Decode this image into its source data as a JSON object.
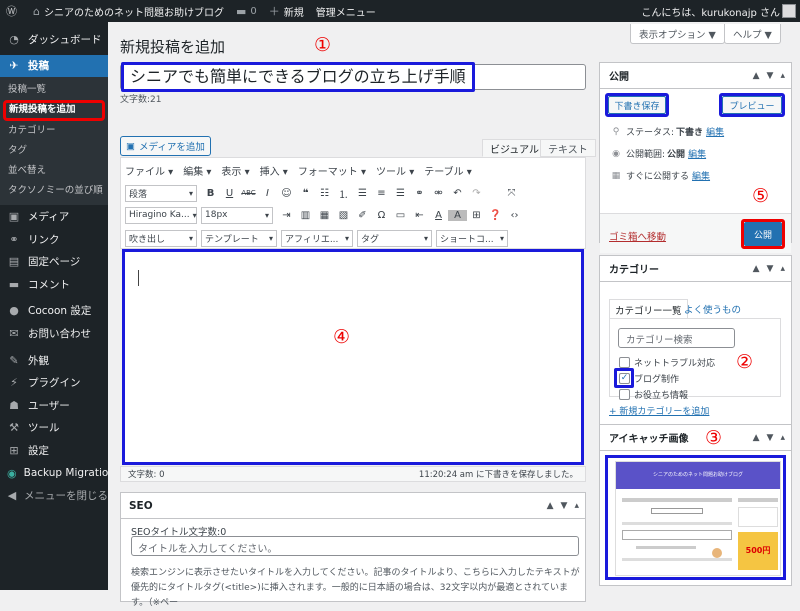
{
  "adminbar": {
    "site_name": "シニアのためのネット問題お助けブログ",
    "comments_count": "0",
    "new_label": "新規",
    "admin_menu_label": "管理メニュー",
    "greeting": "こんにちは、kurukonajp さん"
  },
  "sidebar": {
    "items": [
      {
        "label": "ダッシュボード",
        "icon": "dashboard-icon"
      },
      {
        "label": "投稿",
        "icon": "pin-icon"
      },
      {
        "label": "メディア",
        "icon": "media-icon"
      },
      {
        "label": "リンク",
        "icon": "link-icon"
      },
      {
        "label": "固定ページ",
        "icon": "page-icon"
      },
      {
        "label": "コメント",
        "icon": "comment-icon"
      },
      {
        "label": "Cocoon 設定",
        "icon": "cocoon-icon"
      },
      {
        "label": "お問い合わせ",
        "icon": "mail-icon"
      },
      {
        "label": "外観",
        "icon": "brush-icon"
      },
      {
        "label": "プラグイン",
        "icon": "plugin-icon"
      },
      {
        "label": "ユーザー",
        "icon": "user-icon"
      },
      {
        "label": "ツール",
        "icon": "wrench-icon"
      },
      {
        "label": "設定",
        "icon": "settings-icon"
      },
      {
        "label": "Backup Migration",
        "icon": "backup-icon"
      },
      {
        "label": "メニューを閉じる",
        "icon": "collapse-icon"
      }
    ],
    "submenu": [
      "投稿一覧",
      "新規投稿を追加",
      "カテゴリー",
      "タグ",
      "並べ替え",
      "タクソノミーの並び順"
    ]
  },
  "page": {
    "heading": "新規投稿を追加",
    "screen_options": "表示オプション ▼",
    "help": "ヘルプ ▼",
    "title_value": "シニアでも簡単にできるブログの立ち上げ手順",
    "char_count": "文字数:21"
  },
  "annotations": [
    "①",
    "②",
    "③",
    "④",
    "⑤"
  ],
  "editor": {
    "add_media": "メディアを追加",
    "tab_visual": "ビジュアル",
    "tab_text": "テキスト",
    "menus": [
      "ファイル ▾",
      "編集 ▾",
      "表示 ▾",
      "挿入 ▾",
      "フォーマット ▾",
      "ツール ▾",
      "テーブル ▾"
    ],
    "paragraph_select": "段落",
    "font_select": "Hiragino Ka...",
    "size_select": "18px",
    "row3_selects": [
      "吹き出し",
      "テンプレート",
      "アフィリエ...",
      "タグ",
      "ショートコ..."
    ],
    "word_count": "文字数: 0",
    "draft_saved": "11:20:24 am に下書きを保存しました。"
  },
  "seo": {
    "title": "SEO",
    "title_count": "SEOタイトル文字数:0",
    "title_placeholder": "タイトルを入力してください。",
    "help_text": "検索エンジンに表示させたいタイトルを入力してください。記事のタイトルより、こちらに入力したテキストが優先的にタイトルタグ(<title>)に挿入されます。一般的に日本語の場合は、32文字以内が最適とされています。（※ペー"
  },
  "publish": {
    "title": "公開",
    "save_draft": "下書き保存",
    "preview": "プレビュー",
    "status_label": "ステータス:",
    "status_value": "下書き",
    "visibility_label": "公開範囲:",
    "visibility_value": "公開",
    "schedule_label": "すぐに公開する",
    "edit": "編集",
    "trash": "ゴミ箱へ移動",
    "publish_btn": "公開"
  },
  "categories": {
    "title": "カテゴリー",
    "tab_all": "カテゴリー一覧",
    "tab_popular": "よく使うもの",
    "search_placeholder": "カテゴリー検索",
    "items": [
      {
        "label": "ネットトラブル対応",
        "checked": false
      },
      {
        "label": "ブログ制作",
        "checked": true
      },
      {
        "label": "お役立ち情報",
        "checked": false
      }
    ],
    "add_new": "+ 新規カテゴリーを追加"
  },
  "featured": {
    "title": "アイキャッチ画像",
    "thumb_header": "シニアのためのネット問題お助けブログ",
    "thumb_banner": "500円"
  },
  "colors": {
    "wp_blue": "#2271b1",
    "admin_dark": "#1d2327",
    "annotation_red": "#ee0000",
    "annotation_blue": "#1a1adb"
  }
}
